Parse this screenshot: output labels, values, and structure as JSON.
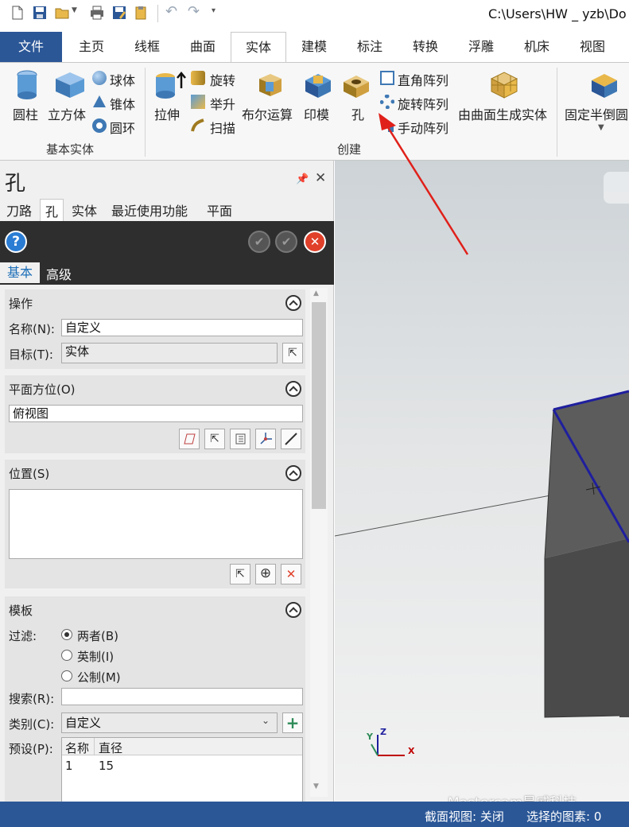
{
  "window": {
    "title": "C:\\Users\\HW _ yzb\\Do"
  },
  "menu_tabs": [
    {
      "label": "文件"
    },
    {
      "label": "主页"
    },
    {
      "label": "线框"
    },
    {
      "label": "曲面"
    },
    {
      "label": "实体"
    },
    {
      "label": "建模"
    },
    {
      "label": "标注"
    },
    {
      "label": "转换"
    },
    {
      "label": "浮雕"
    },
    {
      "label": "机床"
    },
    {
      "label": "视图"
    }
  ],
  "ribbon": {
    "basic_group": {
      "label": "基本实体",
      "cylinder": "圆柱",
      "cube": "立方体",
      "sphere": "球体",
      "cone": "锥体",
      "torus": "圆环"
    },
    "create_group": {
      "label": "创建",
      "extrude": "拉伸",
      "revolve": "旋转",
      "loft": "举升",
      "sweep": "扫描",
      "boolean": "布尔运算",
      "imprint": "印模",
      "hole": "孔",
      "rect_pattern": "直角阵列",
      "rotate_pattern": "旋转阵列",
      "manual_pattern": "手动阵列",
      "from_surfaces": "由曲面生成实体"
    },
    "fixed_chamfer": "固定半倒圆"
  },
  "panel": {
    "title": "孔",
    "tabs": [
      {
        "label": "刀路"
      },
      {
        "label": "孔"
      },
      {
        "label": "实体"
      },
      {
        "label": "最近使用功能"
      },
      {
        "label": "平面"
      }
    ],
    "subtabs": {
      "basic": "基本",
      "advanced": "高级"
    },
    "operation": {
      "header": "操作",
      "name_label": "名称(N):",
      "name_value": "自定义",
      "target_label": "目标(T):",
      "target_value": "实体"
    },
    "plane": {
      "header": "平面方位(O)",
      "value": "俯视图"
    },
    "position": {
      "header": "位置(S)"
    },
    "template": {
      "header": "模板",
      "filter_label": "过滤:",
      "filter_options": [
        "两者(B)",
        "英制(I)",
        "公制(M)"
      ],
      "filter_selected": 0,
      "search_label": "搜索(R):",
      "search_value": "",
      "category_label": "类别(C):",
      "category_value": "自定义",
      "preset_label": "预设(P):",
      "preset_columns": [
        "名称",
        "直径"
      ],
      "preset_rows": [
        [
          "1",
          "15"
        ]
      ]
    }
  },
  "viewport": {
    "axes": {
      "x": "X",
      "y": "Y",
      "z": "Z"
    },
    "watermark": "Mastercam昊威科技"
  },
  "status": {
    "section_view": "截面视图: 关闭",
    "selected": "选择的图素: 0"
  },
  "colors": {
    "brand_blue": "#2b5797",
    "close_red": "#e0402a",
    "arrow_red": "#e0201a"
  }
}
